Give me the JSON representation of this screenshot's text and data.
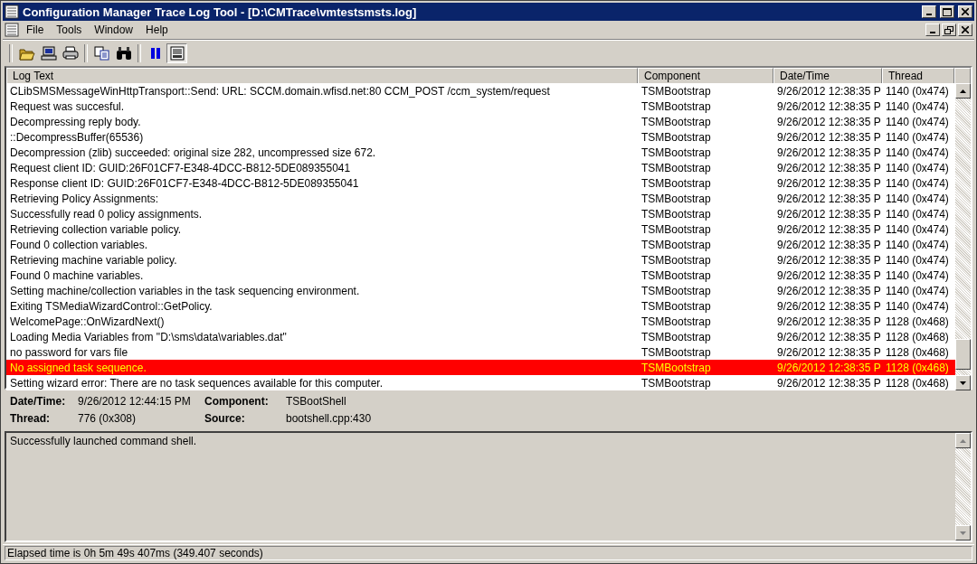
{
  "window": {
    "title": "Configuration Manager Trace Log Tool - [D:\\CMTrace\\vmtestsmsts.log]"
  },
  "menu": [
    "File",
    "Tools",
    "Window",
    "Help"
  ],
  "toolbar": [
    {
      "kind": "open",
      "pressed": false
    },
    {
      "kind": "computer",
      "pressed": false
    },
    {
      "kind": "print",
      "pressed": false
    },
    {
      "kind": "copy",
      "pressed": false
    },
    {
      "kind": "find",
      "pressed": false
    },
    {
      "kind": "pause",
      "pressed": false
    },
    {
      "kind": "details",
      "pressed": true
    }
  ],
  "table": {
    "columns": [
      "Log Text",
      "Component",
      "Date/Time",
      "Thread"
    ],
    "rows": [
      {
        "text": "CLibSMSMessageWinHttpTransport::Send: URL: SCCM.domain.wfisd.net:80  CCM_POST /ccm_system/request",
        "component": "TSMBootstrap",
        "datetime": "9/26/2012 12:38:35 P",
        "thread": "1140 (0x474)",
        "error": false
      },
      {
        "text": "Request was succesful.",
        "component": "TSMBootstrap",
        "datetime": "9/26/2012 12:38:35 P",
        "thread": "1140 (0x474)",
        "error": false
      },
      {
        "text": "Decompressing reply body.",
        "component": "TSMBootstrap",
        "datetime": "9/26/2012 12:38:35 P",
        "thread": "1140 (0x474)",
        "error": false
      },
      {
        "text": "::DecompressBuffer(65536)",
        "component": "TSMBootstrap",
        "datetime": "9/26/2012 12:38:35 P",
        "thread": "1140 (0x474)",
        "error": false
      },
      {
        "text": "Decompression (zlib) succeeded: original size 282, uncompressed size 672.",
        "component": "TSMBootstrap",
        "datetime": "9/26/2012 12:38:35 P",
        "thread": "1140 (0x474)",
        "error": false
      },
      {
        "text": "Request client ID: GUID:26F01CF7-E348-4DCC-B812-5DE089355041",
        "component": "TSMBootstrap",
        "datetime": "9/26/2012 12:38:35 P",
        "thread": "1140 (0x474)",
        "error": false
      },
      {
        "text": "Response client ID: GUID:26F01CF7-E348-4DCC-B812-5DE089355041",
        "component": "TSMBootstrap",
        "datetime": "9/26/2012 12:38:35 P",
        "thread": "1140 (0x474)",
        "error": false
      },
      {
        "text": "Retrieving Policy Assignments:",
        "component": "TSMBootstrap",
        "datetime": "9/26/2012 12:38:35 P",
        "thread": "1140 (0x474)",
        "error": false
      },
      {
        "text": "Successfully read 0 policy assignments.",
        "component": "TSMBootstrap",
        "datetime": "9/26/2012 12:38:35 P",
        "thread": "1140 (0x474)",
        "error": false
      },
      {
        "text": "Retrieving collection variable policy.",
        "component": "TSMBootstrap",
        "datetime": "9/26/2012 12:38:35 P",
        "thread": "1140 (0x474)",
        "error": false
      },
      {
        "text": "Found 0 collection variables.",
        "component": "TSMBootstrap",
        "datetime": "9/26/2012 12:38:35 P",
        "thread": "1140 (0x474)",
        "error": false
      },
      {
        "text": "Retrieving machine variable policy.",
        "component": "TSMBootstrap",
        "datetime": "9/26/2012 12:38:35 P",
        "thread": "1140 (0x474)",
        "error": false
      },
      {
        "text": "Found 0 machine variables.",
        "component": "TSMBootstrap",
        "datetime": "9/26/2012 12:38:35 P",
        "thread": "1140 (0x474)",
        "error": false
      },
      {
        "text": "Setting machine/collection variables in the task sequencing environment.",
        "component": "TSMBootstrap",
        "datetime": "9/26/2012 12:38:35 P",
        "thread": "1140 (0x474)",
        "error": false
      },
      {
        "text": "Exiting TSMediaWizardControl::GetPolicy.",
        "component": "TSMBootstrap",
        "datetime": "9/26/2012 12:38:35 P",
        "thread": "1140 (0x474)",
        "error": false
      },
      {
        "text": "WelcomePage::OnWizardNext()",
        "component": "TSMBootstrap",
        "datetime": "9/26/2012 12:38:35 P",
        "thread": "1128 (0x468)",
        "error": false
      },
      {
        "text": "Loading Media Variables from \"D:\\sms\\data\\variables.dat\"",
        "component": "TSMBootstrap",
        "datetime": "9/26/2012 12:38:35 P",
        "thread": "1128 (0x468)",
        "error": false
      },
      {
        "text": "no password for vars file",
        "component": "TSMBootstrap",
        "datetime": "9/26/2012 12:38:35 P",
        "thread": "1128 (0x468)",
        "error": false
      },
      {
        "text": "No assigned task sequence.",
        "component": "TSMBootstrap",
        "datetime": "9/26/2012 12:38:35 P",
        "thread": "1128 (0x468)",
        "error": true
      },
      {
        "text": "Setting wizard error: There are no task sequences available for this computer.",
        "component": "TSMBootstrap",
        "datetime": "9/26/2012 12:38:35 P",
        "thread": "1128 (0x468)",
        "error": false
      }
    ]
  },
  "details": {
    "fields": [
      {
        "label": "Date/Time:",
        "value": "9/26/2012 12:44:15 PM"
      },
      {
        "label": "Component:",
        "value": "TSBootShell"
      },
      {
        "label": "Thread:",
        "value": "776 (0x308)"
      },
      {
        "label": "Source:",
        "value": "bootshell.cpp:430"
      }
    ],
    "message": "Successfully launched command shell."
  },
  "status_bar": "Elapsed time is 0h 5m 49s 407ms (349.407 seconds)"
}
